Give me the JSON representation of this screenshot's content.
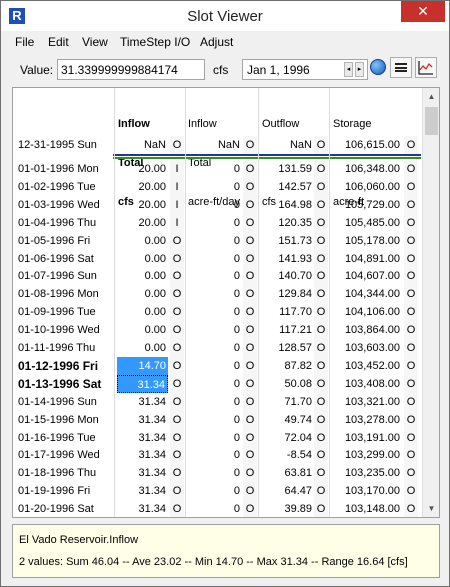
{
  "window": {
    "title": "Slot Viewer",
    "close_glyph": "✕",
    "app_icon_glyph": "R"
  },
  "menu": [
    {
      "label": "File"
    },
    {
      "label": "Edit"
    },
    {
      "label": "View"
    },
    {
      "label": "TimeStep I/O"
    },
    {
      "label": "Adjust"
    }
  ],
  "toolbar": {
    "value_label": "Value:",
    "value": "31.339999999884174",
    "units": "cfs",
    "date": "Jan 1, 1996",
    "prev_glyph": "◂",
    "next_glyph": "▸"
  },
  "columns": [
    {
      "line1": "Inflow",
      "line2": "Total",
      "line3": "cfs",
      "bold": true
    },
    {
      "line1": "Inflow",
      "line2": "Total",
      "line3": "acre-ft/day",
      "bold": false
    },
    {
      "line1": "Outflow",
      "line2": "",
      "line3": "cfs",
      "bold": false
    },
    {
      "line1": "Storage",
      "line2": "",
      "line3": "acre-ft",
      "bold": false
    }
  ],
  "initial_row": {
    "date": "12-31-1995 Sun",
    "c1": "NaN",
    "f1": "O",
    "c2": "NaN",
    "f2": "O",
    "c3": "NaN",
    "f3": "O",
    "c4": "106,615.00",
    "f4": "O"
  },
  "rows": [
    {
      "date": "01-01-1996 Mon",
      "c1": "20.00",
      "f1": "I",
      "c2": "0",
      "f2": "O",
      "c3": "131.59",
      "f3": "O",
      "c4": "106,348.00",
      "f4": "O"
    },
    {
      "date": "01-02-1996 Tue",
      "c1": "20.00",
      "f1": "I",
      "c2": "0",
      "f2": "O",
      "c3": "142.57",
      "f3": "O",
      "c4": "106,060.00",
      "f4": "O"
    },
    {
      "date": "01-03-1996 Wed",
      "c1": "20.00",
      "f1": "I",
      "c2": "0",
      "f2": "O",
      "c3": "164.98",
      "f3": "O",
      "c4": "105,729.00",
      "f4": "O"
    },
    {
      "date": "01-04-1996 Thu",
      "c1": "20.00",
      "f1": "I",
      "c2": "0",
      "f2": "O",
      "c3": "120.35",
      "f3": "O",
      "c4": "105,485.00",
      "f4": "O"
    },
    {
      "date": "01-05-1996 Fri",
      "c1": "0.00",
      "f1": "O",
      "c2": "0",
      "f2": "O",
      "c3": "151.73",
      "f3": "O",
      "c4": "105,178.00",
      "f4": "O"
    },
    {
      "date": "01-06-1996 Sat",
      "c1": "0.00",
      "f1": "O",
      "c2": "0",
      "f2": "O",
      "c3": "141.93",
      "f3": "O",
      "c4": "104,891.00",
      "f4": "O"
    },
    {
      "date": "01-07-1996 Sun",
      "c1": "0.00",
      "f1": "O",
      "c2": "0",
      "f2": "O",
      "c3": "140.70",
      "f3": "O",
      "c4": "104,607.00",
      "f4": "O"
    },
    {
      "date": "01-08-1996 Mon",
      "c1": "0.00",
      "f1": "O",
      "c2": "0",
      "f2": "O",
      "c3": "129.84",
      "f3": "O",
      "c4": "104,344.00",
      "f4": "O"
    },
    {
      "date": "01-09-1996 Tue",
      "c1": "0.00",
      "f1": "O",
      "c2": "0",
      "f2": "O",
      "c3": "117.70",
      "f3": "O",
      "c4": "104,106.00",
      "f4": "O"
    },
    {
      "date": "01-10-1996 Wed",
      "c1": "0.00",
      "f1": "O",
      "c2": "0",
      "f2": "O",
      "c3": "117.21",
      "f3": "O",
      "c4": "103,864.00",
      "f4": "O"
    },
    {
      "date": "01-11-1996 Thu",
      "c1": "0.00",
      "f1": "O",
      "c2": "0",
      "f2": "O",
      "c3": "128.57",
      "f3": "O",
      "c4": "103,603.00",
      "f4": "O"
    },
    {
      "date": "01-12-1996 Fri",
      "c1": "14.70",
      "f1": "O",
      "c2": "0",
      "f2": "O",
      "c3": "87.82",
      "f3": "O",
      "c4": "103,452.00",
      "f4": "O",
      "bold": true,
      "sel": 1
    },
    {
      "date": "01-13-1996 Sat",
      "c1": "31.34",
      "f1": "O",
      "c2": "0",
      "f2": "O",
      "c3": "50.08",
      "f3": "O",
      "c4": "103,408.00",
      "f4": "O",
      "bold": true,
      "sel": 2
    },
    {
      "date": "01-14-1996 Sun",
      "c1": "31.34",
      "f1": "O",
      "c2": "0",
      "f2": "O",
      "c3": "71.70",
      "f3": "O",
      "c4": "103,321.00",
      "f4": "O"
    },
    {
      "date": "01-15-1996 Mon",
      "c1": "31.34",
      "f1": "O",
      "c2": "0",
      "f2": "O",
      "c3": "49.74",
      "f3": "O",
      "c4": "103,278.00",
      "f4": "O"
    },
    {
      "date": "01-16-1996 Tue",
      "c1": "31.34",
      "f1": "O",
      "c2": "0",
      "f2": "O",
      "c3": "72.04",
      "f3": "O",
      "c4": "103,191.00",
      "f4": "O"
    },
    {
      "date": "01-17-1996 Wed",
      "c1": "31.34",
      "f1": "O",
      "c2": "0",
      "f2": "O",
      "c3": "-8.54",
      "f3": "O",
      "c4": "103,299.00",
      "f4": "O"
    },
    {
      "date": "01-18-1996 Thu",
      "c1": "31.34",
      "f1": "O",
      "c2": "0",
      "f2": "O",
      "c3": "63.81",
      "f3": "O",
      "c4": "103,235.00",
      "f4": "O"
    },
    {
      "date": "01-19-1996 Fri",
      "c1": "31.34",
      "f1": "O",
      "c2": "0",
      "f2": "O",
      "c3": "64.47",
      "f3": "O",
      "c4": "103,170.00",
      "f4": "O"
    },
    {
      "date": "01-20-1996 Sat",
      "c1": "31.34",
      "f1": "O",
      "c2": "0",
      "f2": "O",
      "c3": "39.89",
      "f3": "O",
      "c4": "103,148.00",
      "f4": "O"
    }
  ],
  "status": {
    "slot_name": "El Vado Reservoir.Inflow",
    "summary": "2 values:  Sum 46.04 -- Ave 23.02 -- Min 14.70 -- Max 31.34 -- Range 16.64 [cfs]"
  },
  "colors": {
    "selection": "#3399ff",
    "close": "#c7302b",
    "band_blue": "#1f3c8a",
    "band_green": "#2f8f2f",
    "status_bg": "#ffffe8"
  }
}
